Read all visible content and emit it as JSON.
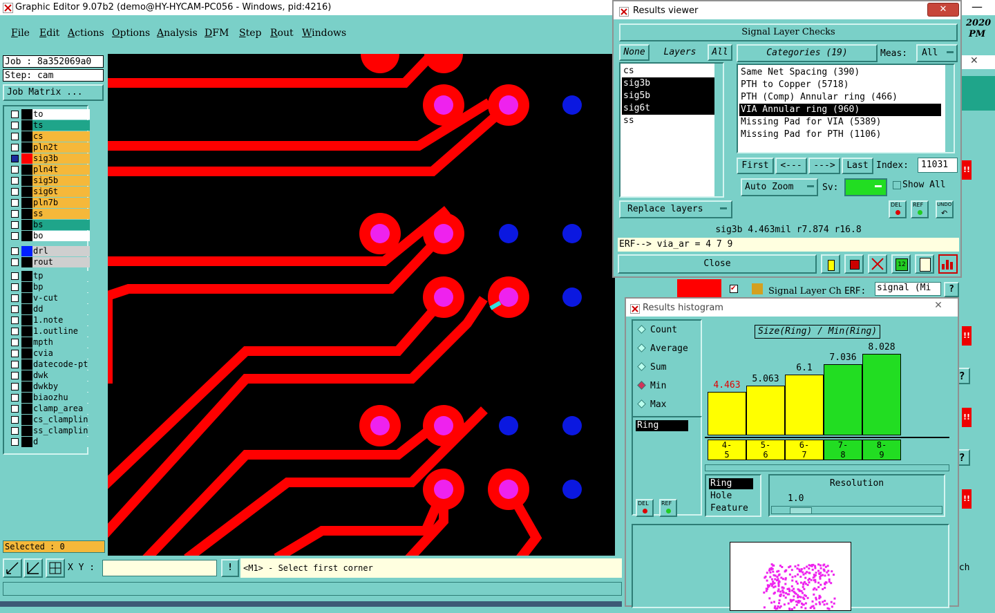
{
  "main_window": {
    "title": "Graphic Editor 9.07b2 (demo@HY-HYCAM-PC056 - Windows, pid:4216)",
    "menu": [
      "File",
      "Edit",
      "Actions",
      "Options",
      "Analysis",
      "DFM",
      "Step",
      "Rout",
      "Windows"
    ]
  },
  "left_panel": {
    "job": "Job : 8a352069a0",
    "step": "Step: cam",
    "job_matrix": "Job Matrix ...",
    "layers_top": [
      {
        "name": "to",
        "color": "#ffffff",
        "swatch": "black",
        "on": false
      },
      {
        "name": "ts",
        "color": "#1fa58a",
        "swatch": "black",
        "on": false
      },
      {
        "name": "cs",
        "color": "#f5b83a",
        "swatch": "black",
        "on": false
      },
      {
        "name": "pln2t",
        "color": "#f5b83a",
        "swatch": "black",
        "on": false
      },
      {
        "name": "sig3b",
        "color": "#f5b83a",
        "swatch": "red",
        "on": true
      },
      {
        "name": "pln4t",
        "color": "#f5b83a",
        "swatch": "black",
        "on": false
      },
      {
        "name": "sig5b",
        "color": "#f5b83a",
        "swatch": "black",
        "on": false
      },
      {
        "name": "sig6t",
        "color": "#f5b83a",
        "swatch": "black",
        "on": false
      },
      {
        "name": "pln7b",
        "color": "#f5b83a",
        "swatch": "black",
        "on": false
      },
      {
        "name": "ss",
        "color": "#f5b83a",
        "swatch": "black",
        "on": false
      },
      {
        "name": "bs",
        "color": "#1fa58a",
        "swatch": "black",
        "on": false
      },
      {
        "name": "bo",
        "color": "#ffffff",
        "swatch": "black",
        "on": false
      }
    ],
    "layers_drill": [
      {
        "name": "drl",
        "color": "#cfcfcf",
        "swatch": "blue",
        "on": false
      },
      {
        "name": "rout",
        "color": "#cfcfcf",
        "swatch": "black",
        "on": false
      }
    ],
    "layers_misc": [
      {
        "name": "tp",
        "color": "#7ad0c8",
        "swatch": "black",
        "on": false
      },
      {
        "name": "bp",
        "color": "#7ad0c8",
        "swatch": "black",
        "on": false
      },
      {
        "name": "v-cut",
        "color": "#7ad0c8",
        "swatch": "black",
        "on": false
      },
      {
        "name": "dd",
        "color": "#7ad0c8",
        "swatch": "black",
        "on": false
      },
      {
        "name": "1.note",
        "color": "#7ad0c8",
        "swatch": "black",
        "on": false
      },
      {
        "name": "1.outline",
        "color": "#7ad0c8",
        "swatch": "black",
        "on": false
      },
      {
        "name": "mpth",
        "color": "#7ad0c8",
        "swatch": "black",
        "on": false
      },
      {
        "name": "cvia",
        "color": "#7ad0c8",
        "swatch": "black",
        "on": false
      },
      {
        "name": "datecode-pt",
        "color": "#7ad0c8",
        "swatch": "black",
        "on": false
      },
      {
        "name": "dwk",
        "color": "#7ad0c8",
        "swatch": "black",
        "on": false
      },
      {
        "name": "dwkby",
        "color": "#7ad0c8",
        "swatch": "black",
        "on": false
      },
      {
        "name": "biaozhu",
        "color": "#7ad0c8",
        "swatch": "black",
        "on": false
      },
      {
        "name": "clamp_area",
        "color": "#7ad0c8",
        "swatch": "black",
        "on": false
      },
      {
        "name": "cs_clamplin",
        "color": "#7ad0c8",
        "swatch": "black",
        "on": false
      },
      {
        "name": "ss_clamplin",
        "color": "#7ad0c8",
        "swatch": "black",
        "on": false
      },
      {
        "name": "d",
        "color": "#7ad0c8",
        "swatch": "black",
        "on": false
      }
    ],
    "selected": "Selected : 0"
  },
  "status": {
    "xy_label": "X Y :",
    "xy_value": "",
    "prompt": "<M1> - Select first corner",
    "warn": "!"
  },
  "results_viewer": {
    "title": "Results viewer",
    "header": "Signal Layer Checks",
    "none_btn": "None",
    "layers_label": "Layers",
    "all_btn": "All",
    "layers": [
      {
        "name": "cs",
        "selected": false
      },
      {
        "name": "sig3b",
        "selected": true
      },
      {
        "name": "sig5b",
        "selected": true
      },
      {
        "name": "sig6t",
        "selected": true
      },
      {
        "name": "ss",
        "selected": false
      }
    ],
    "categories_label": "Categories (19)",
    "meas_label": "Meas:",
    "meas_value": "All",
    "categories": [
      {
        "name": "Same Net Spacing (390)",
        "selected": false
      },
      {
        "name": "PTH to Copper (5718)",
        "selected": false
      },
      {
        "name": "PTH (Comp) Annular ring (466)",
        "selected": false
      },
      {
        "name": "VIA Annular ring (960)",
        "selected": true
      },
      {
        "name": "Missing Pad for VIA (5389)",
        "selected": false
      },
      {
        "name": "Missing Pad for PTH (1106)",
        "selected": false
      }
    ],
    "first_btn": "First",
    "prev_btn": "<---",
    "next_btn": "--->",
    "last_btn": "Last",
    "index_label": "Index:",
    "index_value": "11031",
    "auto_zoom": "Auto Zoom",
    "sv_label": "Sv:",
    "show_all": "Show All",
    "replace_layers": "Replace layers",
    "del": "DEL",
    "ref": "REF",
    "undo": "UNDO",
    "result_line": "sig3b 4.463mil  r7.874  r16.8",
    "erf_line": "ERF--> via_ar = 4 7 9",
    "close": "Close"
  },
  "histogram": {
    "title": "Results histogram",
    "modes": [
      {
        "name": "Count",
        "on": false
      },
      {
        "name": "Average",
        "on": false
      },
      {
        "name": "Sum",
        "on": false
      },
      {
        "name": "Min",
        "on": true
      },
      {
        "name": "Max",
        "on": false
      }
    ],
    "list_item": "Ring",
    "del": "DEL",
    "ref": "REF",
    "metric_options": [
      "Ring",
      "Hole",
      "Feature"
    ],
    "resolution_label": "Resolution",
    "resolution_value": "1.0",
    "chart_data": {
      "type": "bar",
      "title": "Size(Ring) / Min(Ring)",
      "categories": [
        "4-\n5",
        "5-\n6",
        "6-\n7",
        "7-\n8",
        "8-\n9"
      ],
      "values": [
        4.463,
        5.063,
        6.1,
        7.036,
        8.028
      ],
      "labels": [
        "4.463",
        "5.063",
        "6.1",
        "7.036",
        "8.028"
      ],
      "colors": [
        "#ffff00",
        "#ffff00",
        "#ffff00",
        "#22dd22",
        "#22dd22"
      ],
      "label_colors": [
        "#e00000",
        "#000000",
        "#000000",
        "#000000",
        "#000000"
      ],
      "ylim": [
        0,
        8.028
      ]
    }
  },
  "background_fragments": {
    "clock_year": "2020",
    "clock_ampm": "PM",
    "erf_label": "ERF:",
    "signal_field": "signal (Mi",
    "signal_tab": "Signal Layer Ch",
    "nch": "nch",
    "q": "?",
    "bang": "!!"
  }
}
